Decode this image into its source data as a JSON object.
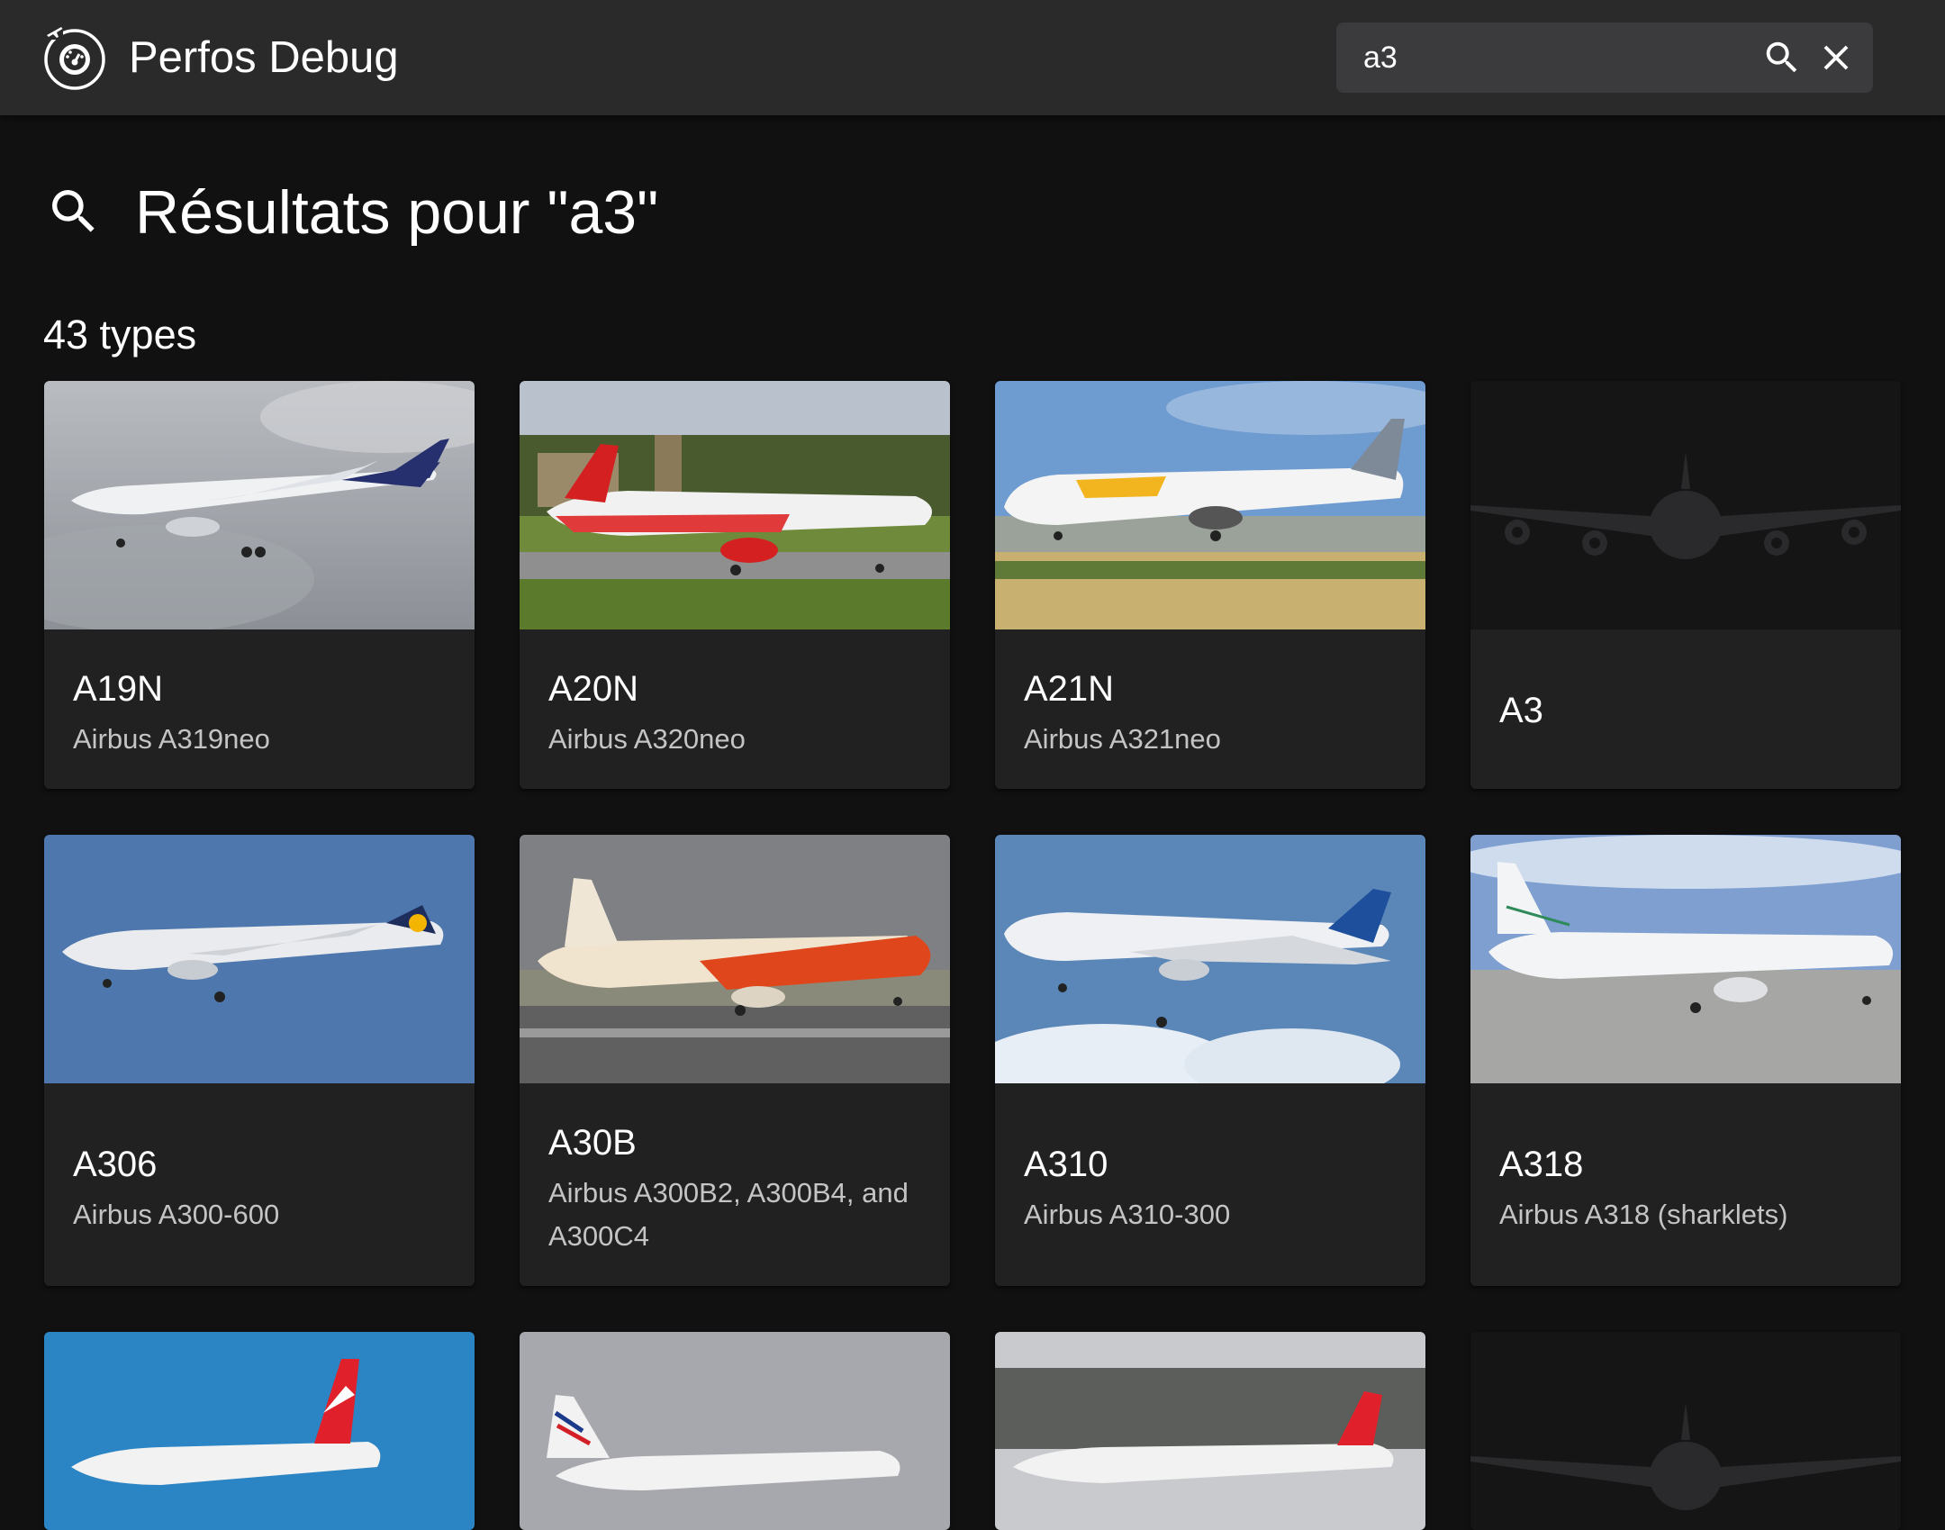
{
  "appbar": {
    "title": "Perfos Debug",
    "logo_icon": "gauge-plane-icon",
    "search": {
      "value": "a3",
      "search_icon": "search-icon",
      "clear_icon": "close-icon"
    }
  },
  "results": {
    "heading": "Résultats pour \"a3\"",
    "heading_icon": "search-icon",
    "count_label": "43 types"
  },
  "colors": {
    "background": "#111112",
    "appbar": "#2a2a2b",
    "card": "#212122",
    "secondary_text": "#c4c4c4"
  },
  "cards": [
    {
      "code": "A19N",
      "name": "Airbus A319neo",
      "photo": "Airbus A319neo house livery"
    },
    {
      "code": "A20N",
      "name": "Airbus A320neo",
      "photo": "Air Malta A320neo"
    },
    {
      "code": "A21N",
      "name": "Airbus A321neo",
      "photo": "Primera Air A321neo"
    },
    {
      "code": "A3",
      "name": "",
      "photo": "placeholder silhouette"
    },
    {
      "code": "A306",
      "name": "Airbus A300-600",
      "photo": "Lufthansa A300-600"
    },
    {
      "code": "A30B",
      "name": "Airbus A300B2, A300B4, and A300C4",
      "photo": "TNT A300B4"
    },
    {
      "code": "A310",
      "name": "Airbus A310-300",
      "photo": "Air Transat A310"
    },
    {
      "code": "A318",
      "name": "Airbus A318 (sharklets)",
      "photo": "A318 Elite"
    },
    {
      "code": "",
      "name": "",
      "photo": "Austrian A319"
    },
    {
      "code": "",
      "name": "",
      "photo": "Air France A320"
    },
    {
      "code": "",
      "name": "",
      "photo": "Austrian A321"
    },
    {
      "code": "",
      "name": "",
      "photo": "placeholder silhouette"
    }
  ]
}
